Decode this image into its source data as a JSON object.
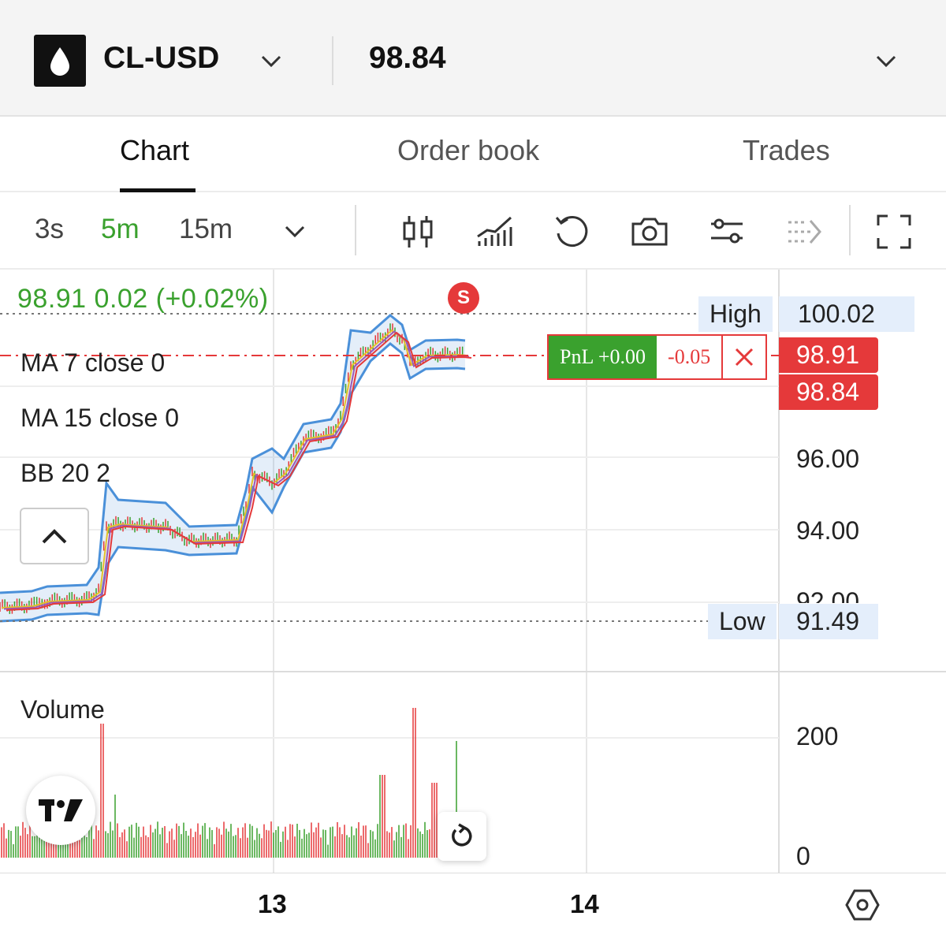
{
  "header": {
    "symbol": "CL-USD",
    "price": "98.84",
    "logo_icon": "oil-drop-icon",
    "symbol_dropdown_icon": "chevron-down-icon",
    "price_dropdown_icon": "chevron-down-icon"
  },
  "tabs": [
    {
      "label": "Chart",
      "active": true
    },
    {
      "label": "Order book",
      "active": false
    },
    {
      "label": "Trades",
      "active": false
    }
  ],
  "toolbar": {
    "timeframes": [
      {
        "label": "3s",
        "active": false
      },
      {
        "label": "5m",
        "active": true
      },
      {
        "label": "15m",
        "active": false
      }
    ],
    "icons": [
      "candlestick-icon",
      "indicators-icon",
      "undo-icon",
      "camera-icon",
      "settings-sliders-icon",
      "trade-lines-icon",
      "fullscreen-icon"
    ]
  },
  "chart": {
    "ohlc_text": "98.91  0.02 (+0.02%)",
    "sell_marker": "S",
    "high_label": "High",
    "high_value": "100.02",
    "low_label": "Low",
    "low_value": "91.49",
    "last_price_tag": "98.91",
    "mark_price_tag": "98.84",
    "pnl_label": "PnL +0.00",
    "pnl_change": "-0.05",
    "legends": [
      "MA 7 close 0",
      "MA 15 close 0",
      "BB 20 2"
    ],
    "price_axis": [
      "96.00",
      "94.00",
      "92.00"
    ],
    "volume_label": "Volume",
    "volume_axis": [
      "200",
      "0"
    ],
    "date_axis": [
      "13",
      "14"
    ],
    "colors": {
      "up": "#3aa12e",
      "down": "#e5393a",
      "bollinger": "#4a90d9",
      "accent": "#3aa12e"
    }
  }
}
